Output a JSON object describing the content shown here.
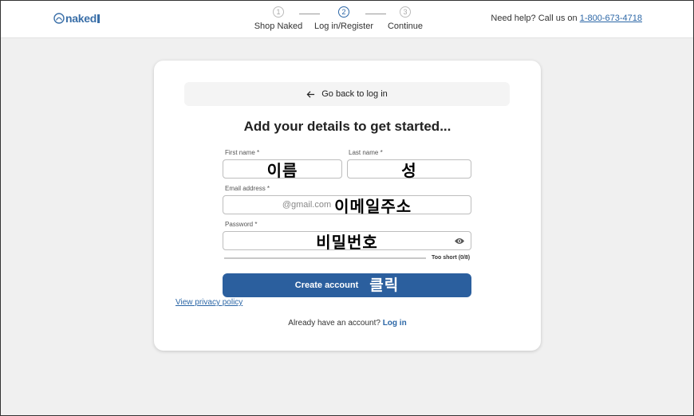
{
  "brand": {
    "name": "naked"
  },
  "steps": [
    {
      "number": "1",
      "label": "Shop Naked"
    },
    {
      "number": "2",
      "label": "Log in/Register"
    },
    {
      "number": "3",
      "label": "Continue"
    }
  ],
  "help": {
    "text": "Need help? Call us on",
    "phone": "1-800-673-4718"
  },
  "form": {
    "back_label": "Go back to log in",
    "title": "Add your details to get started...",
    "first_name_label": "First name *",
    "first_name_annotation": "이름",
    "last_name_label": "Last name *",
    "last_name_annotation": "성",
    "email_label": "Email address *",
    "email_value": "@gmail.com",
    "email_annotation": "이메일주소",
    "password_label": "Password *",
    "password_annotation": "비밀번호",
    "strength_text": "Too short (0/8)",
    "create_label": "Create account",
    "create_annotation": "클릭",
    "privacy_label": "View privacy policy",
    "login_prompt": "Already have an account?",
    "login_link": "Log in"
  },
  "colors": {
    "accent": "#2b5f9e",
    "link": "#2b66a6",
    "background": "#f0f0f0"
  },
  "icons": [
    "logo-mark-icon",
    "arrow-left-icon",
    "eye-icon"
  ]
}
